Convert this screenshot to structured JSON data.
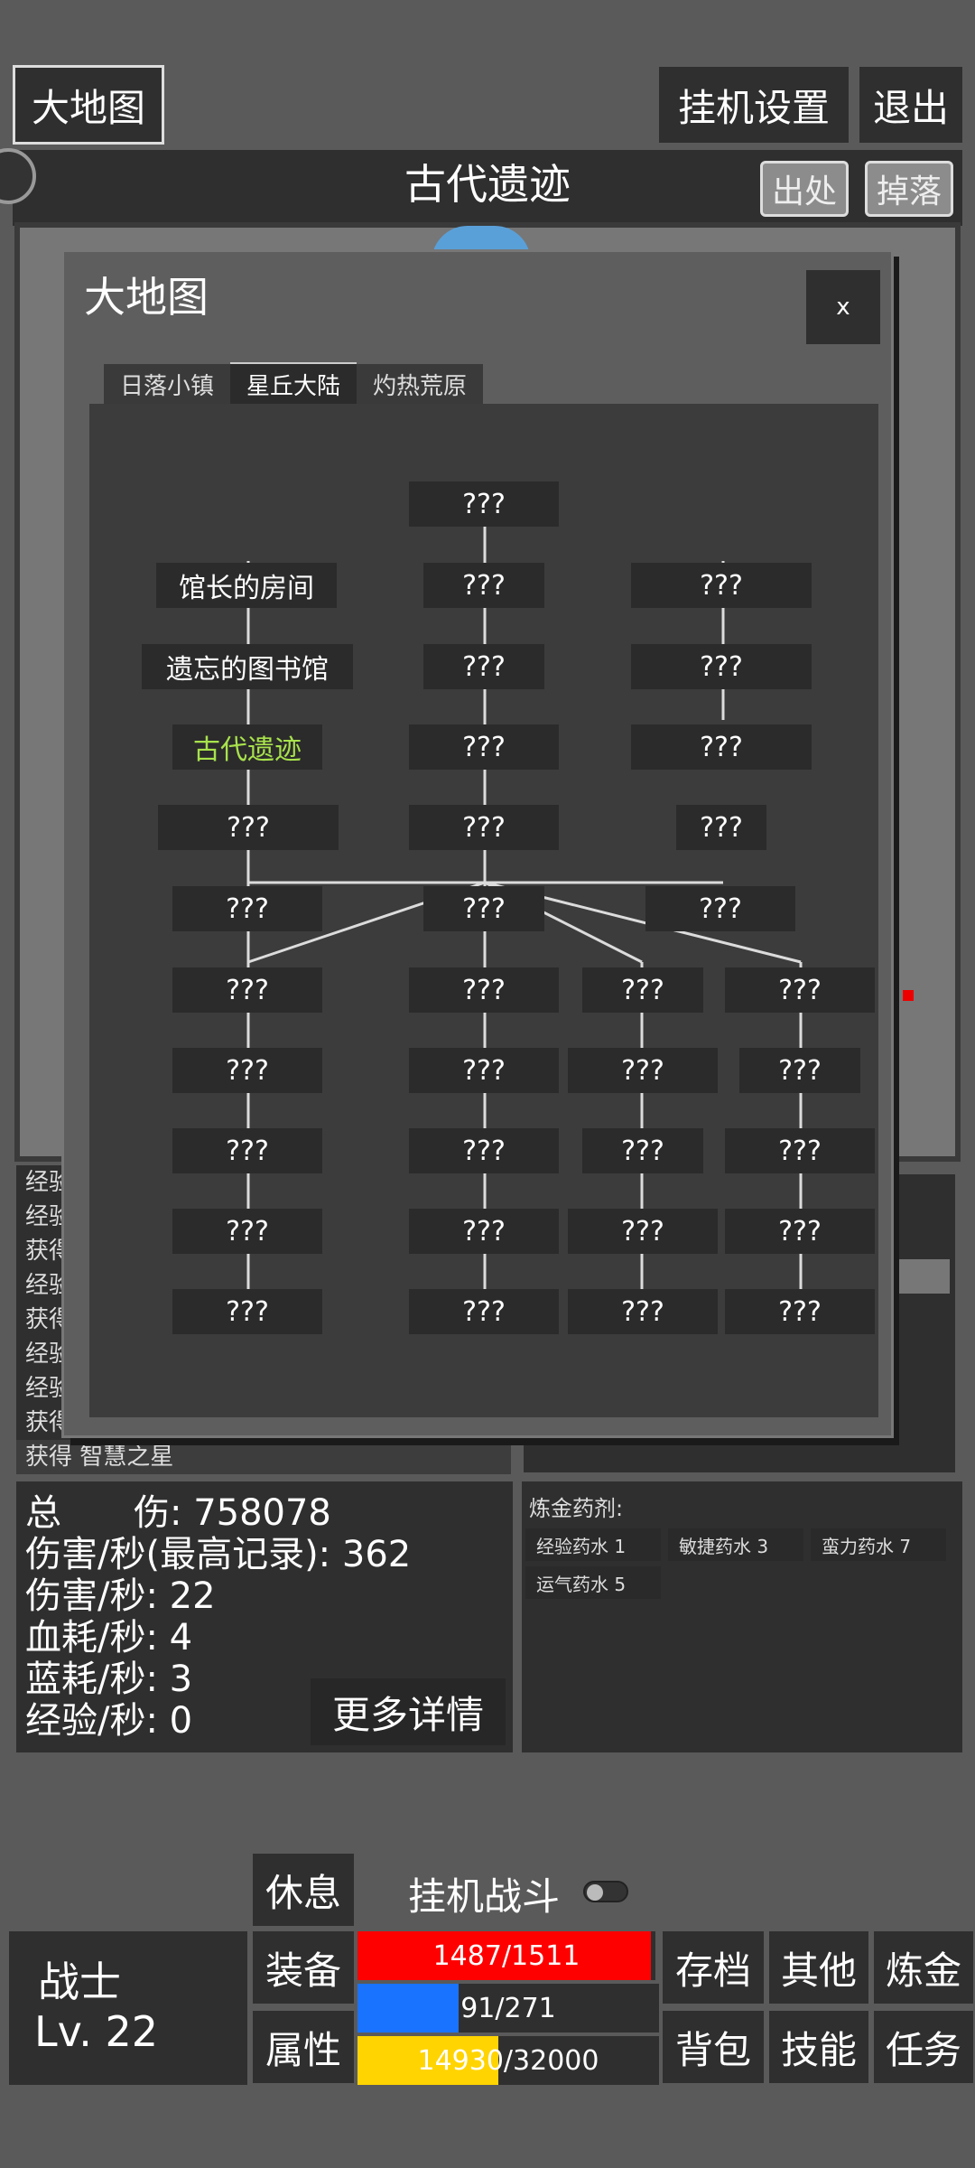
{
  "top": {
    "world_map_button": "大地图",
    "afk_settings_button": "挂机设置",
    "exit_button": "退出"
  },
  "location": {
    "title": "古代遗迹",
    "source_button": "出处",
    "drops_button": "掉落"
  },
  "map_dialog": {
    "title": "大地图",
    "close": "x",
    "tabs": [
      {
        "label": "日落小镇",
        "active": false
      },
      {
        "label": "星丘大陆",
        "active": true
      },
      {
        "label": "灼热荒原",
        "active": false
      }
    ],
    "nodes": [
      "???",
      "馆长的房间",
      "???",
      "???",
      "遗忘的图书馆",
      "???",
      "???",
      "古代遗迹",
      "???",
      "???",
      "???",
      "???",
      "???",
      "???",
      "???",
      "???",
      "???",
      "???",
      "???",
      "???",
      "???",
      "???",
      "???",
      "???",
      "???",
      "???",
      "???",
      "???",
      "???",
      "???",
      "???",
      "???",
      "???",
      "???",
      "???",
      "???"
    ],
    "current_node": "古代遗迹"
  },
  "log": {
    "lines": [
      "经验",
      "经验",
      "获得",
      "经验",
      "获得",
      "经验",
      "经验",
      "获得"
    ],
    "last_line": "获得 智慧之星"
  },
  "stats": {
    "total_damage": "总　　伤: 758078",
    "dps_record": "伤害/秒(最高记录): 362",
    "dps": "伤害/秒: 22",
    "hp_cost": "血耗/秒: 4",
    "mp_cost": "蓝耗/秒: 3",
    "exp_rate": "经验/秒: 0",
    "more_details_button": "更多详情"
  },
  "alchemy": {
    "title": "炼金药剂:",
    "potions": [
      "经验药水 1",
      "敏捷药水 3",
      "蛮力药水 7",
      "运气药水 5"
    ]
  },
  "bottom": {
    "rest_button": "休息",
    "afk_battle_label": "挂机战斗",
    "afk_toggle_on": false,
    "class_name": "战士",
    "level": "Lv. 22",
    "equipment_button": "装备",
    "attributes_button": "属性",
    "hp_text": "1487/1511",
    "hp_fraction": 0.984,
    "mp_text": "91/271",
    "mp_fraction": 0.336,
    "exp_text": "14930/32000",
    "exp_fraction": 0.467,
    "save_button": "存档",
    "other_button": "其他",
    "alchemy_button": "炼金",
    "bag_button": "背包",
    "skills_button": "技能",
    "quests_button": "任务",
    "colors": {
      "hp": "#ff0000",
      "mp": "#1a73ff",
      "exp": "#ffd400",
      "current_node": "#a8e24c"
    }
  }
}
